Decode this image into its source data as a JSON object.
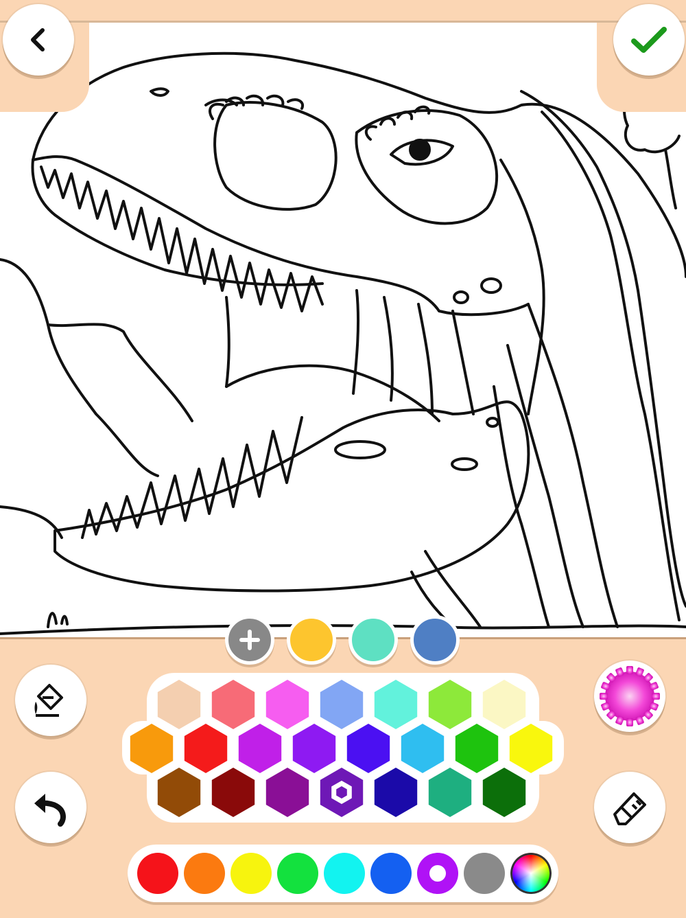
{
  "toolbar": {
    "back_icon": "chevron-left-icon",
    "confirm_icon": "checkmark-icon",
    "confirm_color": "#1c9a1c"
  },
  "canvas": {
    "subject": "dinosaur-line-art"
  },
  "quick_colors": {
    "add_icon": "plus-icon",
    "swatches": [
      "#fdc52e",
      "#5ee0c2",
      "#4f7fc4"
    ]
  },
  "tools": {
    "fill_icon": "paint-bucket-icon",
    "undo_icon": "undo-arrow-icon",
    "pattern_icon": "gear-gradient-icon",
    "eraser_icon": "eraser-icon"
  },
  "hex_palette": {
    "row1": [
      "#f4cfb0",
      "#f76b77",
      "#f65df0",
      "#82a6f4",
      "#62f2dc",
      "#8de93a",
      "#fbf7c4"
    ],
    "row2": [
      "#f89a0c",
      "#f41b1b",
      "#c020e8",
      "#8e1af2",
      "#4b10f2",
      "#2fbef0",
      "#1ec30e",
      "#f9f70d"
    ],
    "row3": [
      "#924b07",
      "#8a0a0a",
      "#8a0f96",
      "#6e18b6",
      "#1b0aa9",
      "#1eaf80",
      "#0c6f0a"
    ],
    "selected": "#6e18b6"
  },
  "basic_colors": {
    "swatches": [
      "#f5131a",
      "#fb7a10",
      "#f7f40e",
      "#13e13e",
      "#12f3f0",
      "#1460f1",
      "#b012f6",
      "#8a8a8a"
    ],
    "selected": "#b012f6",
    "custom_icon": "color-wheel-icon"
  }
}
